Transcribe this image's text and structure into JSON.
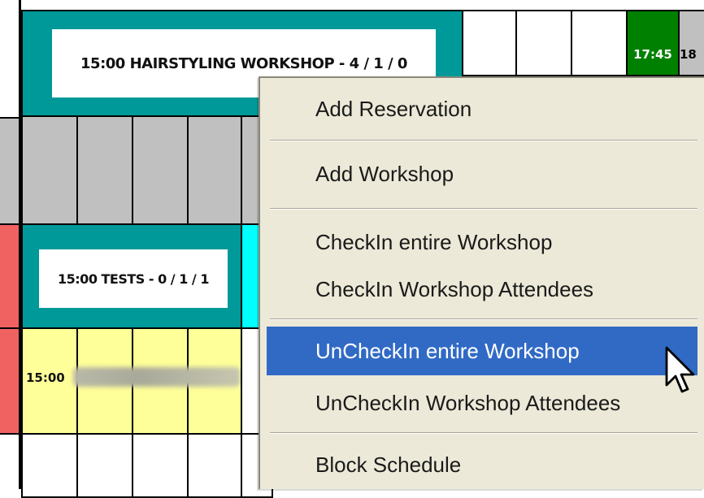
{
  "schedule": {
    "workshops": [
      {
        "label": "15:00 HAIRSTYLING WORKSHOP - 4 / 1 / 0"
      },
      {
        "label": "15:00 TESTS - 0 / 1 / 1"
      }
    ],
    "appointment": {
      "time": "15:00"
    },
    "time_chips": [
      {
        "label": "17:45",
        "color": "#008000"
      },
      {
        "label": "18",
        "color": "#c0c0c0"
      }
    ]
  },
  "context_menu": {
    "items": [
      {
        "label": "Add Reservation"
      },
      {
        "label": "Add Workshop"
      },
      {
        "label": "CheckIn entire Workshop"
      },
      {
        "label": "CheckIn Workshop Attendees"
      },
      {
        "label": "UnCheckIn entire Workshop",
        "highlighted": true
      },
      {
        "label": "UnCheckIn Workshop Attendees"
      },
      {
        "label": "Block Schedule"
      }
    ],
    "highlight_color": "#316ac5",
    "background_color": "#ece9d8"
  },
  "colors": {
    "workshop_frame": "#009999",
    "gray_row": "#c0c0c0",
    "yellow_row": "#ffff99",
    "red_edge": "#f06262",
    "cyan_cell": "#00ffff"
  },
  "icons": [
    "mouse-cursor-icon"
  ]
}
